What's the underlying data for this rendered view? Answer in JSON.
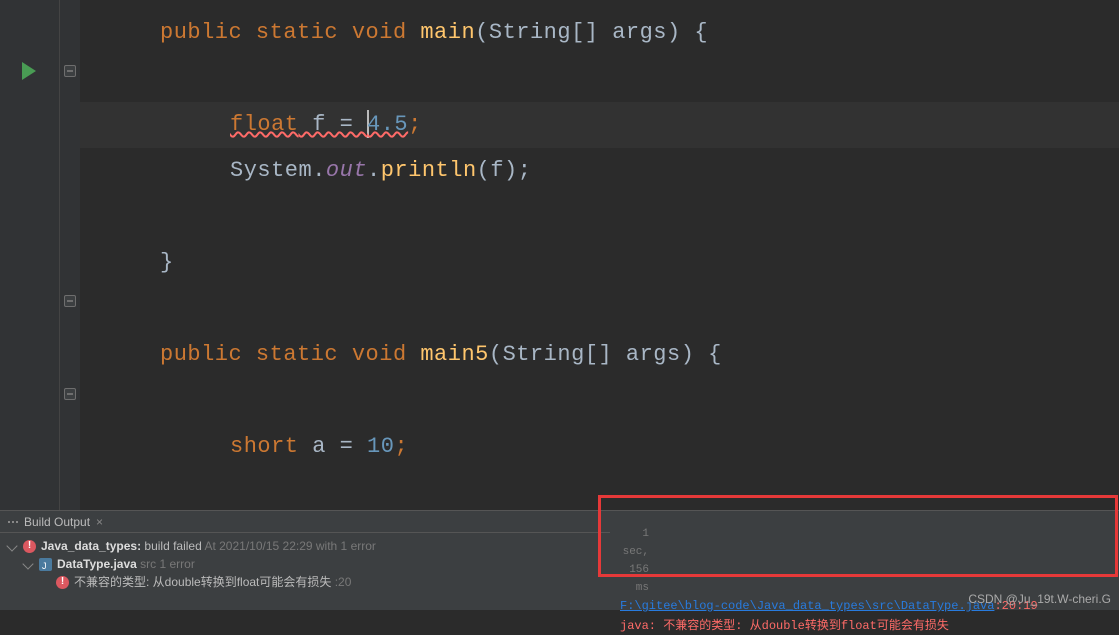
{
  "code": {
    "line1": {
      "kw1": "public",
      "kw2": "static",
      "kw3": "void",
      "method": "main",
      "params_open": "(String[] ",
      "param_name": "args",
      "params_close": ") {"
    },
    "line3": {
      "type": "float",
      "var": " f = ",
      "val": "4.5",
      "semi": ";"
    },
    "line4": {
      "cls": "System",
      "dot1": ".",
      "field": "out",
      "dot2": ".",
      "method": "println",
      "args": "(f);"
    },
    "line6": {
      "brace": "}"
    },
    "line8": {
      "kw1": "public",
      "kw2": "static",
      "kw3": "void",
      "method": "main5",
      "params_open": "(String[] ",
      "param_name": "args",
      "params_close": ") {"
    },
    "line10": {
      "type": "short",
      "var": " a = ",
      "val": "10",
      "semi": ";"
    }
  },
  "panel": {
    "tab_label": "Build Output",
    "tree": {
      "root_name": "Java_data_types:",
      "root_status": " build failed",
      "root_time": " At 2021/10/15 22:29 with 1 error",
      "file_name": "DataType.java",
      "file_status": " src 1 error",
      "err_msg": "不兼容的类型: 从double转换到float可能会有损失",
      "err_line": " :20"
    },
    "timing": "1 sec, 156 ms",
    "output": {
      "path": "F:\\gitee\\blog-code\\Java_data_types\\src\\DataType.java",
      "loc": ":20:19",
      "prefix": "java: ",
      "msg": "不兼容的类型: 从double转换到float可能会有损失"
    }
  },
  "watermark": "CSDN @Ju_19t.W-cheri.G"
}
